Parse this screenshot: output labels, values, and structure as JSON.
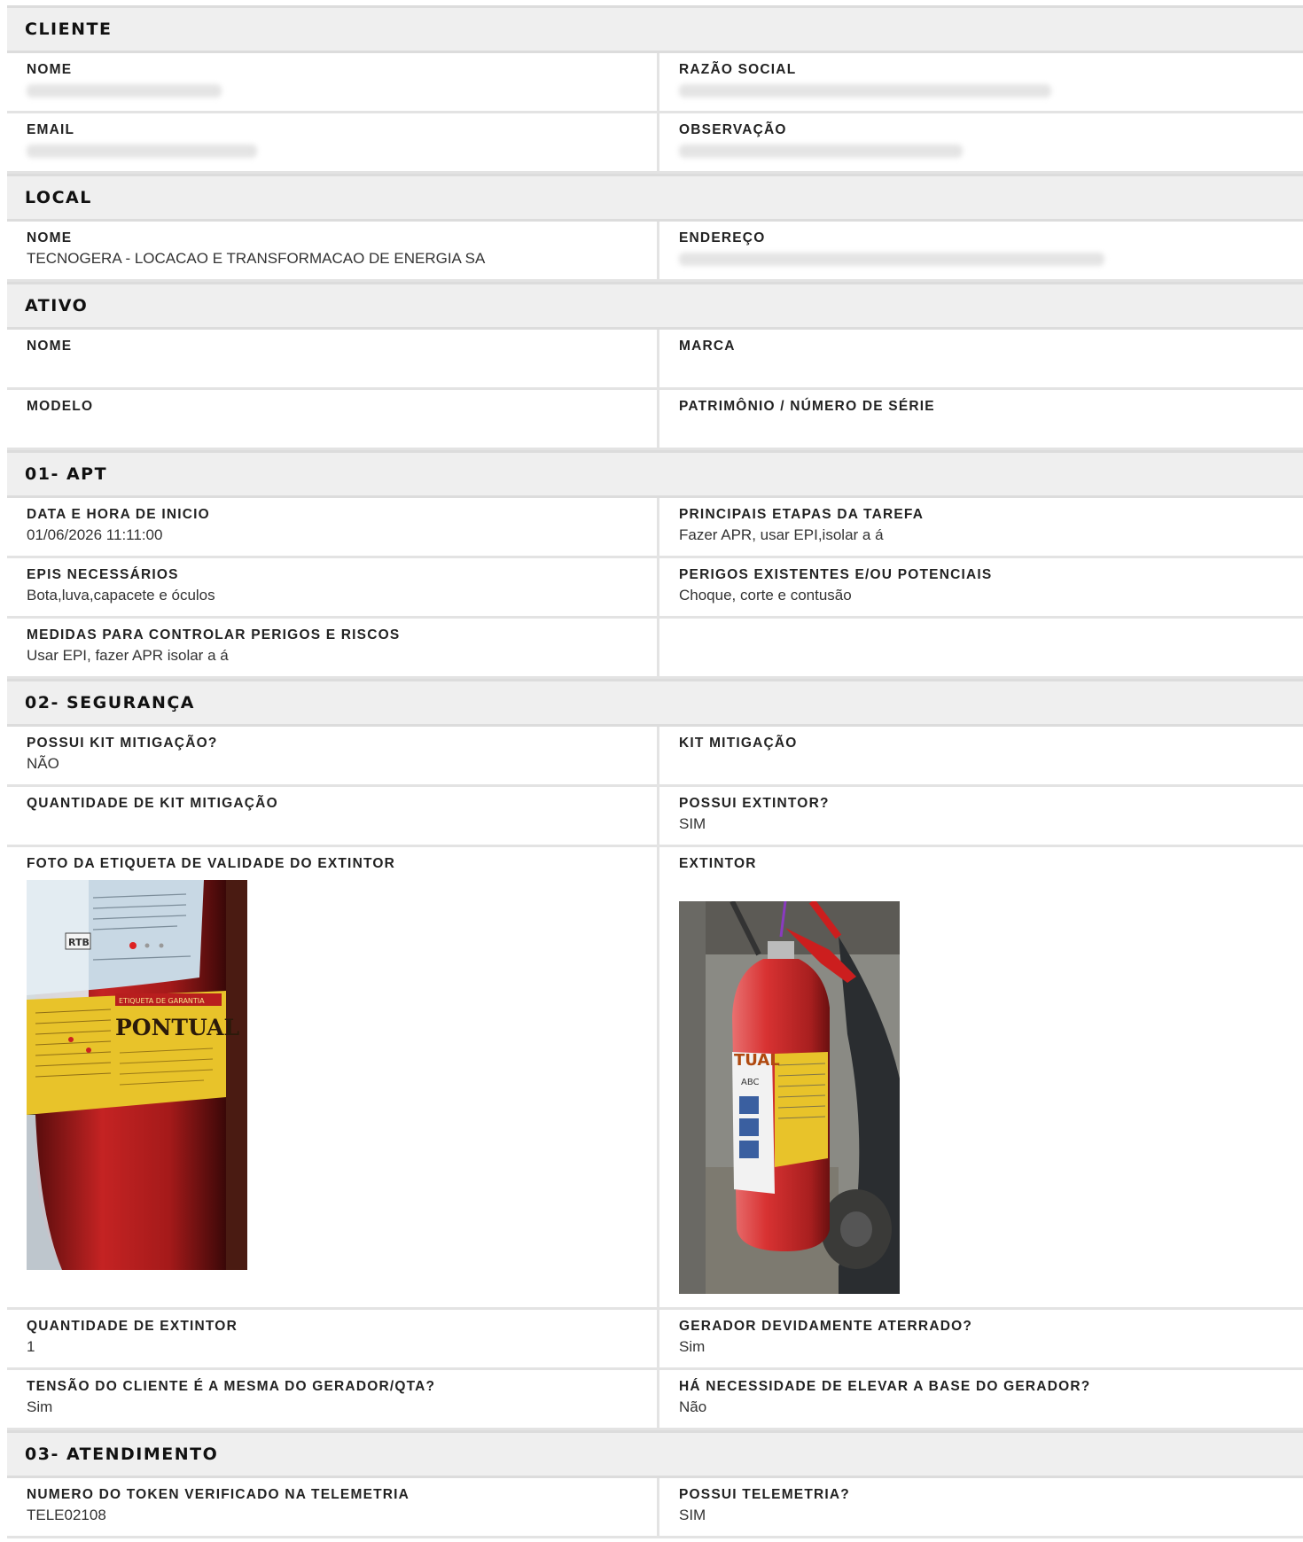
{
  "cliente": {
    "title": "CLIENTE",
    "nome_label": "NOME",
    "razao_label": "RAZÃO SOCIAL",
    "email_label": "EMAIL",
    "obs_label": "OBSERVAÇÃO"
  },
  "local": {
    "title": "LOCAL",
    "nome_label": "NOME",
    "nome_value": "TECNOGERA - LOCACAO E TRANSFORMACAO DE ENERGIA SA",
    "endereco_label": "ENDEREÇO"
  },
  "ativo": {
    "title": "ATIVO",
    "nome_label": "NOME",
    "marca_label": "MARCA",
    "modelo_label": "MODELO",
    "patrimonio_label": "PATRIMÔNIO / NÚMERO DE SÉRIE"
  },
  "apt": {
    "title": "01- APT",
    "inicio_label": "DATA E HORA DE INICIO",
    "inicio_value": "01/06/2026 11:11:00",
    "etapas_label": "PRINCIPAIS ETAPAS DA TAREFA",
    "etapas_value": "Fazer APR, usar EPI,isolar a á",
    "epis_label": "EPIS NECESSÁRIOS",
    "epis_value": "Bota,luva,capacete e óculos",
    "perigos_label": "PERIGOS EXISTENTES E/OU POTENCIAIS",
    "perigos_value": "Choque, corte e contusão",
    "medidas_label": "MEDIDAS PARA CONTROLAR PERIGOS E RISCOS",
    "medidas_value": "Usar EPI, fazer APR isolar a á"
  },
  "seguranca": {
    "title": "02- SEGURANÇA",
    "possui_kit_label": "POSSUI KIT MITIGAÇÃO?",
    "possui_kit_value": "NÃO",
    "kit_label": "KIT MITIGAÇÃO",
    "qtd_kit_label": "QUANTIDADE DE KIT MITIGAÇÃO",
    "possui_extintor_label": "POSSUI EXTINTOR?",
    "possui_extintor_value": "SIM",
    "foto_etiqueta_label": "FOTO DA ETIQUETA DE VALIDADE DO EXTINTOR",
    "extintor_label": "EXTINTOR",
    "qtd_extintor_label": "QUANTIDADE DE EXTINTOR",
    "qtd_extintor_value": "1",
    "aterrado_label": "GERADOR DEVIDAMENTE ATERRADO?",
    "aterrado_value": "Sim",
    "tensao_label": "TENSÃO DO CLIENTE É A MESMA DO GERADOR/QTA?",
    "tensao_value": "Sim",
    "elevar_label": "HÁ NECESSIDADE DE ELEVAR A BASE DO GERADOR?",
    "elevar_value": "Não",
    "photo1_text": {
      "rtb": "RTB",
      "etiqueta": "ETIQUETA DE GARANTIA",
      "brand": "PONTUAL"
    },
    "photo2_text": {
      "brand": "TUAL",
      "type": "ABC"
    }
  },
  "atendimento": {
    "title": "03- ATENDIMENTO",
    "token_label": "NUMERO DO TOKEN VERIFICADO NA TELEMETRIA",
    "token_value": "TELE02108",
    "telemetria_label": "POSSUI TELEMETRIA?",
    "telemetria_value": "SIM"
  },
  "colors": {
    "extinguisher_red": "#b81e1e",
    "label_yellow": "#e8c32a",
    "header_bg": "#efefef"
  }
}
